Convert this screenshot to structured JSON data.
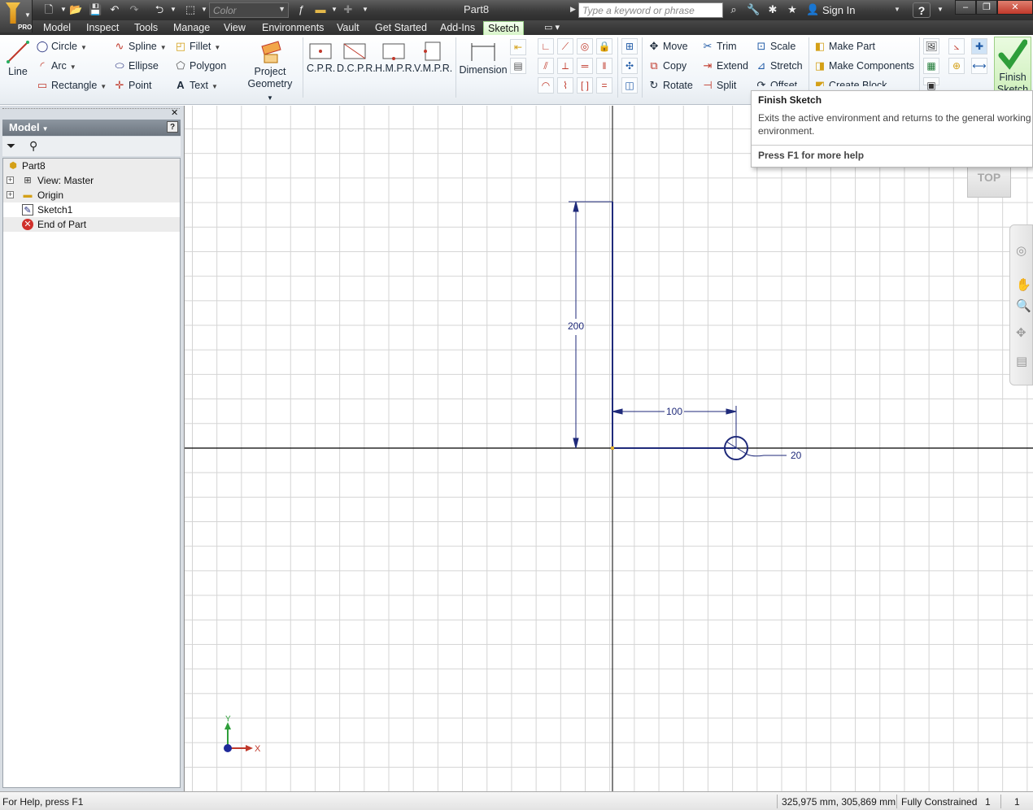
{
  "titlebar": {
    "document_title": "Part8",
    "color_box": "Color",
    "search_placeholder": "Type a keyword or phrase",
    "signin": "Sign In",
    "app_badge": "PRO"
  },
  "menu_tabs": [
    "Model",
    "Inspect",
    "Tools",
    "Manage",
    "View",
    "Environments",
    "Vault",
    "Get Started",
    "Add-Ins",
    "Sketch"
  ],
  "active_tab": "Sketch",
  "ribbon": {
    "draw": {
      "line": "Line",
      "circle": "Circle",
      "arc": "Arc",
      "rectangle": "Rectangle",
      "spline": "Spline",
      "ellipse": "Ellipse",
      "point": "Point",
      "fillet": "Fillet",
      "polygon": "Polygon",
      "text": "Text",
      "project_geometry_1": "Project",
      "project_geometry_2": "Geometry"
    },
    "rect_tools": [
      "C.P.R.",
      "D.C.P.R.",
      "H.M.P.R.",
      "V.M.P.R."
    ],
    "dimension": "Dimension",
    "modify": {
      "move": "Move",
      "copy": "Copy",
      "rotate": "Rotate",
      "trim": "Trim",
      "extend": "Extend",
      "split": "Split",
      "scale": "Scale",
      "stretch": "Stretch",
      "offset": "Offset"
    },
    "layout": {
      "make_part": "Make Part",
      "make_components": "Make Components",
      "create_block": "Create Block"
    },
    "finish_1": "Finish",
    "finish_2": "Sketch"
  },
  "browser": {
    "title": "Model",
    "tree": [
      {
        "label": "Part8",
        "icon": "part-icon"
      },
      {
        "label": "View: Master",
        "icon": "view-icon"
      },
      {
        "label": "Origin",
        "icon": "folder-icon"
      },
      {
        "label": "Sketch1",
        "icon": "sketch-icon"
      },
      {
        "label": "End of Part",
        "icon": "end-of-part-icon"
      }
    ]
  },
  "sketch": {
    "dim_vertical": "200",
    "dim_horizontal": "100",
    "dim_diameter": "20"
  },
  "tooltip": {
    "title": "Finish Sketch",
    "body": "Exits the active environment and returns to the general working environment.",
    "footer": "Press F1 for more help"
  },
  "viewcube": "TOP",
  "axes": {
    "x": "X",
    "y": "Y"
  },
  "statusbar": {
    "help": "For Help, press F1",
    "coords": "325,975 mm, 305,869 mm",
    "constraint": "Fully Constrained",
    "count1": "1",
    "count2": "1"
  },
  "colors": {
    "sketch": "#1f2a7a",
    "active_tab": "#d8f4c8",
    "axis": "#000000"
  }
}
